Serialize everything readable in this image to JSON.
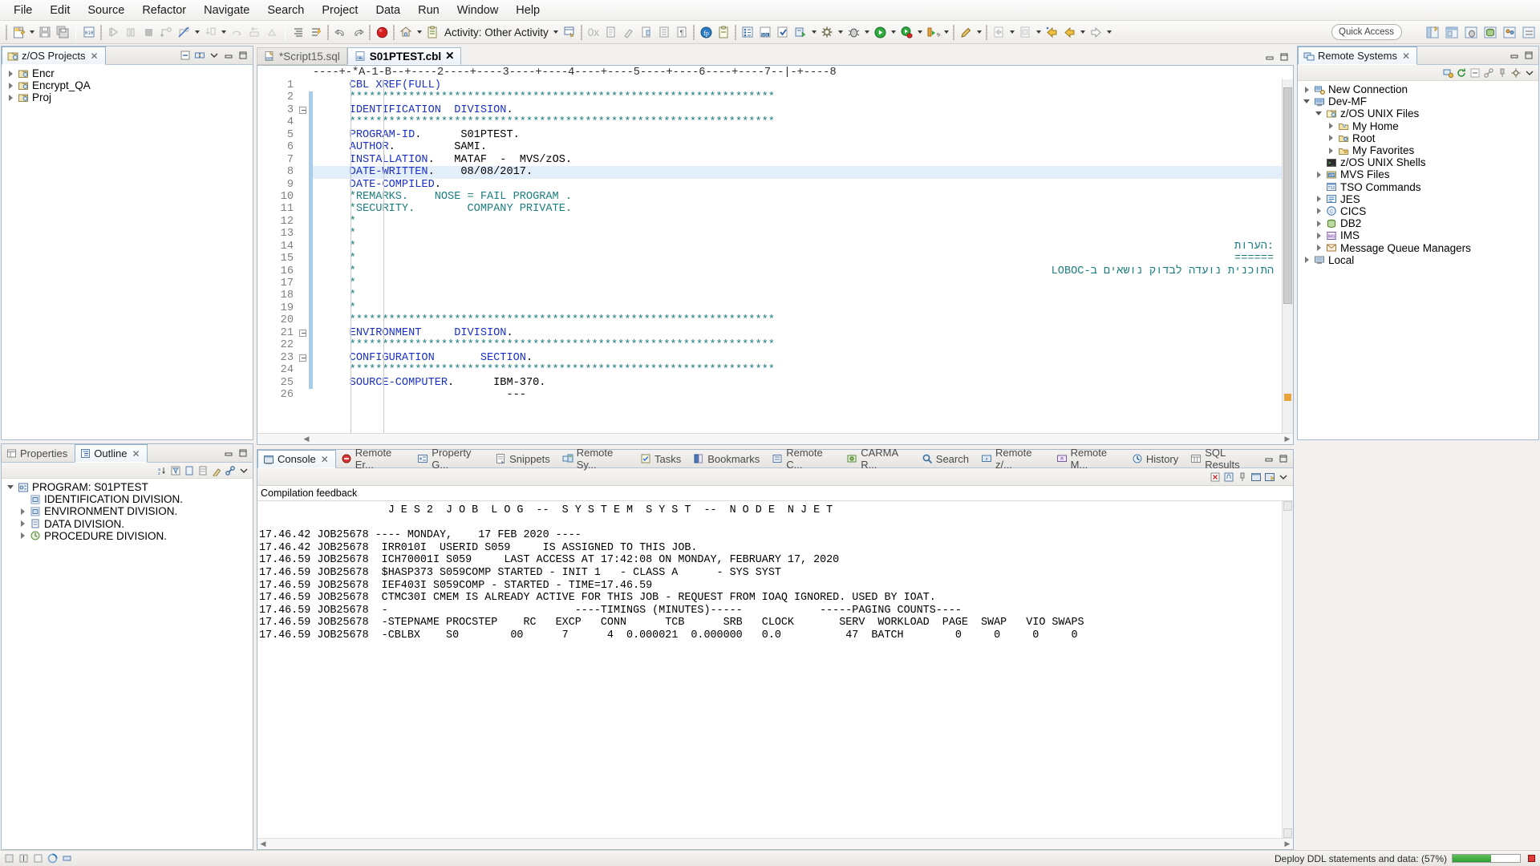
{
  "menubar": {
    "items": [
      "File",
      "Edit",
      "Source",
      "Refactor",
      "Navigate",
      "Search",
      "Project",
      "Data",
      "Run",
      "Window",
      "Help"
    ]
  },
  "toolbar": {
    "activity_label": "Activity: Other Activity",
    "zero_x_label": "0x",
    "quick_access_placeholder": "Quick Access",
    "icons": [
      "new-file-icon",
      "save-icon",
      "save-all-icon",
      "binary-editor-icon",
      "run-icon",
      "pause-icon",
      "stop-icon",
      "step-icon",
      "disconnect-icon",
      "step-into-icon",
      "step-over-icon",
      "step-return-icon",
      "indent-icon",
      "format-icon",
      "undo-icon",
      "redo-icon",
      "record-icon",
      "home-icon",
      "activity-icon",
      "submit-icon",
      "hex-icon",
      "copy-icon",
      "clean-icon",
      "paste-special-icon",
      "list-icon",
      "paragraph-icon",
      "generate-icon",
      "clipboard-icon",
      "properties-icon",
      "sql-icon",
      "check-icon",
      "deploy-icon",
      "debug-icon",
      "run-green-icon",
      "run-bug-icon",
      "coverage-icon",
      "pencil-icon",
      "new-window-icon",
      "new-view-icon",
      "back-icon",
      "backward-icon",
      "forward-icon",
      "perspective-icon"
    ]
  },
  "left_top_panel": {
    "tab_label": "z/OS Projects",
    "tab_icon": "zos-projects-icon",
    "actions": [
      "collapse-all-icon",
      "link-editor-icon",
      "view-menu-icon",
      "minimize-icon",
      "maximize-icon"
    ],
    "tree": [
      {
        "label": "Encr",
        "icon": "project-icon",
        "twist": "collapsed",
        "indent": 0
      },
      {
        "label": "Encrypt_QA",
        "icon": "project-icon",
        "twist": "collapsed",
        "indent": 0
      },
      {
        "label": "Proj",
        "icon": "project-icon",
        "twist": "collapsed",
        "indent": 0
      }
    ]
  },
  "left_bottom_panel": {
    "tabs": [
      {
        "label": "Properties",
        "icon": "properties-icon",
        "active": false
      },
      {
        "label": "Outline",
        "icon": "outline-icon",
        "active": true
      }
    ],
    "actions": [
      "sort-icon",
      "filter-icon",
      "hide-fields-icon",
      "hide-static-icon",
      "hide-nonpublic-icon",
      "link-icon",
      "view-menu-icon",
      "minimize-icon",
      "maximize-icon"
    ],
    "tree": [
      {
        "label": "PROGRAM: S01PTEST",
        "icon": "program-icon",
        "twist": "expanded",
        "indent": 0
      },
      {
        "label": "IDENTIFICATION DIVISION.",
        "icon": "division-icon",
        "twist": "none",
        "indent": 1
      },
      {
        "label": "ENVIRONMENT   DIVISION.",
        "icon": "division-icon",
        "twist": "collapsed",
        "indent": 1
      },
      {
        "label": "DATA        DIVISION.",
        "icon": "data-icon",
        "twist": "collapsed",
        "indent": 1
      },
      {
        "label": "PROCEDURE   DIVISION.",
        "icon": "procedure-icon",
        "twist": "collapsed",
        "indent": 1
      }
    ]
  },
  "editor": {
    "tabs": [
      {
        "label": "*Script15.sql",
        "icon": "sql-file-icon",
        "active": false,
        "dirty": true
      },
      {
        "label": "S01PTEST.cbl",
        "icon": "cbl-file-icon",
        "active": true,
        "dirty": false
      }
    ],
    "ruler": "----+-*A-1-B--+----2----+----3----+----4----+----5----+----6----+----7--|-+----8",
    "highlighted_line": 8,
    "lines": [
      {
        "n": 1,
        "fold": false,
        "segments": [
          {
            "t": "CBL ",
            "c": "kw"
          },
          {
            "t": "XREF(FULL)",
            "c": "kw2"
          }
        ]
      },
      {
        "n": 2,
        "fold": false,
        "segments": [
          {
            "t": "*****************************************************************",
            "c": "cmt"
          }
        ]
      },
      {
        "n": 3,
        "fold": true,
        "segments": [
          {
            "t": "IDENTIFICATION  DIVISION",
            "c": "kw"
          },
          {
            "t": ".",
            "c": "plain"
          }
        ]
      },
      {
        "n": 4,
        "fold": false,
        "segments": [
          {
            "t": "*****************************************************************",
            "c": "cmt"
          }
        ]
      },
      {
        "n": 5,
        "fold": false,
        "segments": [
          {
            "t": "PROGRAM-ID",
            "c": "kw"
          },
          {
            "t": ".      S01PTEST.",
            "c": "plain"
          }
        ]
      },
      {
        "n": 6,
        "fold": false,
        "segments": [
          {
            "t": "AUTHOR",
            "c": "kw"
          },
          {
            "t": ".         SAMI.",
            "c": "plain"
          }
        ]
      },
      {
        "n": 7,
        "fold": false,
        "segments": [
          {
            "t": "INSTALLATION",
            "c": "kw"
          },
          {
            "t": ".   MATAF  -  MVS/zOS.",
            "c": "plain"
          }
        ]
      },
      {
        "n": 8,
        "fold": false,
        "segments": [
          {
            "t": "DATE-WRITTEN",
            "c": "kw"
          },
          {
            "t": ".    08/08/2017.",
            "c": "plain"
          }
        ]
      },
      {
        "n": 9,
        "fold": false,
        "segments": [
          {
            "t": "DATE-COMPILED",
            "c": "kw"
          },
          {
            "t": ".",
            "c": "plain"
          }
        ]
      },
      {
        "n": 10,
        "fold": false,
        "segments": [
          {
            "t": "*REMARKS.    NOSE = FAIL PROGRAM .",
            "c": "cmt"
          }
        ]
      },
      {
        "n": 11,
        "fold": false,
        "segments": [
          {
            "t": "*SECURITY.        COMPANY PRIVATE.",
            "c": "cmt"
          }
        ]
      },
      {
        "n": 12,
        "fold": false,
        "segments": [
          {
            "t": "*",
            "c": "cmt"
          }
        ]
      },
      {
        "n": 13,
        "fold": false,
        "segments": [
          {
            "t": "*",
            "c": "cmt"
          }
        ]
      },
      {
        "n": 14,
        "fold": false,
        "segments": [
          {
            "t": "*",
            "c": "cmt"
          }
        ],
        "right": ":הערות"
      },
      {
        "n": 15,
        "fold": false,
        "segments": [
          {
            "t": "*",
            "c": "cmt"
          }
        ],
        "right": "======"
      },
      {
        "n": 16,
        "fold": false,
        "segments": [
          {
            "t": "*",
            "c": "cmt"
          }
        ],
        "right": "התוכנית נועדה לבדוק נושאים ב-COBOL"
      },
      {
        "n": 17,
        "fold": false,
        "segments": [
          {
            "t": "*",
            "c": "cmt"
          }
        ]
      },
      {
        "n": 18,
        "fold": false,
        "segments": [
          {
            "t": "*",
            "c": "cmt"
          }
        ]
      },
      {
        "n": 19,
        "fold": false,
        "segments": [
          {
            "t": "*",
            "c": "cmt"
          }
        ]
      },
      {
        "n": 20,
        "fold": false,
        "segments": [
          {
            "t": "*****************************************************************",
            "c": "cmt"
          }
        ]
      },
      {
        "n": 21,
        "fold": true,
        "segments": [
          {
            "t": "ENVIRONMENT     DIVISION",
            "c": "kw"
          },
          {
            "t": ".",
            "c": "plain"
          }
        ]
      },
      {
        "n": 22,
        "fold": false,
        "segments": [
          {
            "t": "*****************************************************************",
            "c": "cmt"
          }
        ]
      },
      {
        "n": 23,
        "fold": true,
        "segments": [
          {
            "t": "CONFIGURATION       SECTION",
            "c": "kw"
          },
          {
            "t": ".",
            "c": "plain"
          }
        ]
      },
      {
        "n": 24,
        "fold": false,
        "segments": [
          {
            "t": "*****************************************************************",
            "c": "cmt"
          }
        ]
      },
      {
        "n": 25,
        "fold": false,
        "segments": [
          {
            "t": "SOURCE-COMPUTER",
            "c": "kw"
          },
          {
            "t": ".      IBM-370.",
            "c": "plain"
          }
        ]
      },
      {
        "n": 26,
        "fold": false,
        "segments": [
          {
            "t": "                        ---",
            "c": "plain"
          }
        ]
      }
    ]
  },
  "right_panel": {
    "tab_label": "Remote Systems",
    "tab_icon": "remote-systems-icon",
    "actions": [
      "collapse-all-icon",
      "link-icon",
      "new-connection-icon",
      "pin-icon",
      "view-menu-icon",
      "minimize-icon",
      "maximize-icon"
    ],
    "tree": [
      {
        "label": "New Connection",
        "icon": "new-connection-icon",
        "twist": "collapsed",
        "indent": 0
      },
      {
        "label": "Dev-MF",
        "icon": "connection-icon",
        "twist": "expanded",
        "indent": 0
      },
      {
        "label": "z/OS UNIX Files",
        "icon": "unix-files-icon",
        "twist": "expanded",
        "indent": 1
      },
      {
        "label": "My Home",
        "icon": "folder-home-icon",
        "twist": "collapsed",
        "indent": 2
      },
      {
        "label": "Root",
        "icon": "folder-root-icon",
        "twist": "collapsed",
        "indent": 2
      },
      {
        "label": "My Favorites",
        "icon": "favorites-icon",
        "twist": "collapsed",
        "indent": 2
      },
      {
        "label": "z/OS UNIX Shells",
        "icon": "shell-icon",
        "twist": "none",
        "indent": 1
      },
      {
        "label": "MVS Files",
        "icon": "mvs-files-icon",
        "twist": "collapsed",
        "indent": 1
      },
      {
        "label": "TSO Commands",
        "icon": "tso-icon",
        "twist": "none",
        "indent": 1
      },
      {
        "label": "JES",
        "icon": "jes-icon",
        "twist": "collapsed",
        "indent": 1
      },
      {
        "label": "CICS",
        "icon": "cics-icon",
        "twist": "collapsed",
        "indent": 1
      },
      {
        "label": "DB2",
        "icon": "db2-icon",
        "twist": "collapsed",
        "indent": 1
      },
      {
        "label": "IMS",
        "icon": "ims-icon",
        "twist": "collapsed",
        "indent": 1
      },
      {
        "label": "Message Queue Managers",
        "icon": "mq-icon",
        "twist": "collapsed",
        "indent": 1
      },
      {
        "label": "Local",
        "icon": "local-icon",
        "twist": "collapsed",
        "indent": 0
      }
    ]
  },
  "console": {
    "tabs": [
      {
        "label": "Console",
        "icon": "console-icon",
        "active": true
      },
      {
        "label": "Remote Er...",
        "icon": "error-icon",
        "active": false
      },
      {
        "label": "Property G...",
        "icon": "property-icon",
        "active": false
      },
      {
        "label": "Snippets",
        "icon": "snippets-icon",
        "active": false
      },
      {
        "label": "Remote Sy...",
        "icon": "remote-sys-icon",
        "active": false
      },
      {
        "label": "Tasks",
        "icon": "tasks-icon",
        "active": false
      },
      {
        "label": "Bookmarks",
        "icon": "bookmarks-icon",
        "active": false
      },
      {
        "label": "Remote C...",
        "icon": "remote-c-icon",
        "active": false
      },
      {
        "label": "CARMA R...",
        "icon": "carma-icon",
        "active": false
      },
      {
        "label": "Search",
        "icon": "search-icon",
        "active": false
      },
      {
        "label": "Remote z/...",
        "icon": "remote-z-icon",
        "active": false
      },
      {
        "label": "Remote M...",
        "icon": "remote-m-icon",
        "active": false
      },
      {
        "label": "History",
        "icon": "history-icon",
        "active": false
      },
      {
        "label": "SQL Results",
        "icon": "sql-results-icon",
        "active": false
      }
    ],
    "actions": [
      "clear-icon",
      "scroll-lock-icon",
      "pin-icon",
      "display-console-icon",
      "open-console-icon",
      "view-menu-icon",
      "minimize-icon",
      "maximize-icon"
    ],
    "feedback_label": "Compilation feedback",
    "log_lines": [
      "                    J E S 2  J O B  L O G  --  S Y S T E M  S Y S T  --  N O D E  N J E T",
      "",
      "17.46.42 JOB25678 ---- MONDAY,    17 FEB 2020 ----",
      "17.46.42 JOB25678  IRR010I  USERID S059     IS ASSIGNED TO THIS JOB.",
      "17.46.59 JOB25678  ICH70001I S059     LAST ACCESS AT 17:42:08 ON MONDAY, FEBRUARY 17, 2020",
      "17.46.59 JOB25678  $HASP373 S059COMP STARTED - INIT 1   - CLASS A      - SYS SYST",
      "17.46.59 JOB25678  IEF403I S059COMP - STARTED - TIME=17.46.59",
      "17.46.59 JOB25678  CTMC30I CMEM IS ALREADY ACTIVE FOR THIS JOB - REQUEST FROM IOAQ IGNORED. USED BY IOAT.",
      "17.46.59 JOB25678  -                             ----TIMINGS (MINUTES)-----            -----PAGING COUNTS----",
      "17.46.59 JOB25678  -STEPNAME PROCSTEP    RC   EXCP   CONN      TCB      SRB   CLOCK       SERV  WORKLOAD  PAGE  SWAP   VIO SWAPS",
      "17.46.59 JOB25678  -CBLBX    S0        00      7      4  0.000021  0.000000   0.0          47  BATCH        0     0     0     0"
    ]
  },
  "statusbar": {
    "deploy_text": "Deploy DDL statements and data: (57%)",
    "progress_percent": 57,
    "icons": [
      "writable-icon",
      "insert-icon",
      "smart-insert-icon",
      "progress-icon",
      "thread-icon"
    ]
  },
  "colors": {
    "accent": "#3a6ea5",
    "keyword": "#1a30c8",
    "comment": "#1c7e7e",
    "tab_border": "#a7b8c9",
    "selection": "#e3eefb",
    "progress_green": "#2f9e2f"
  }
}
